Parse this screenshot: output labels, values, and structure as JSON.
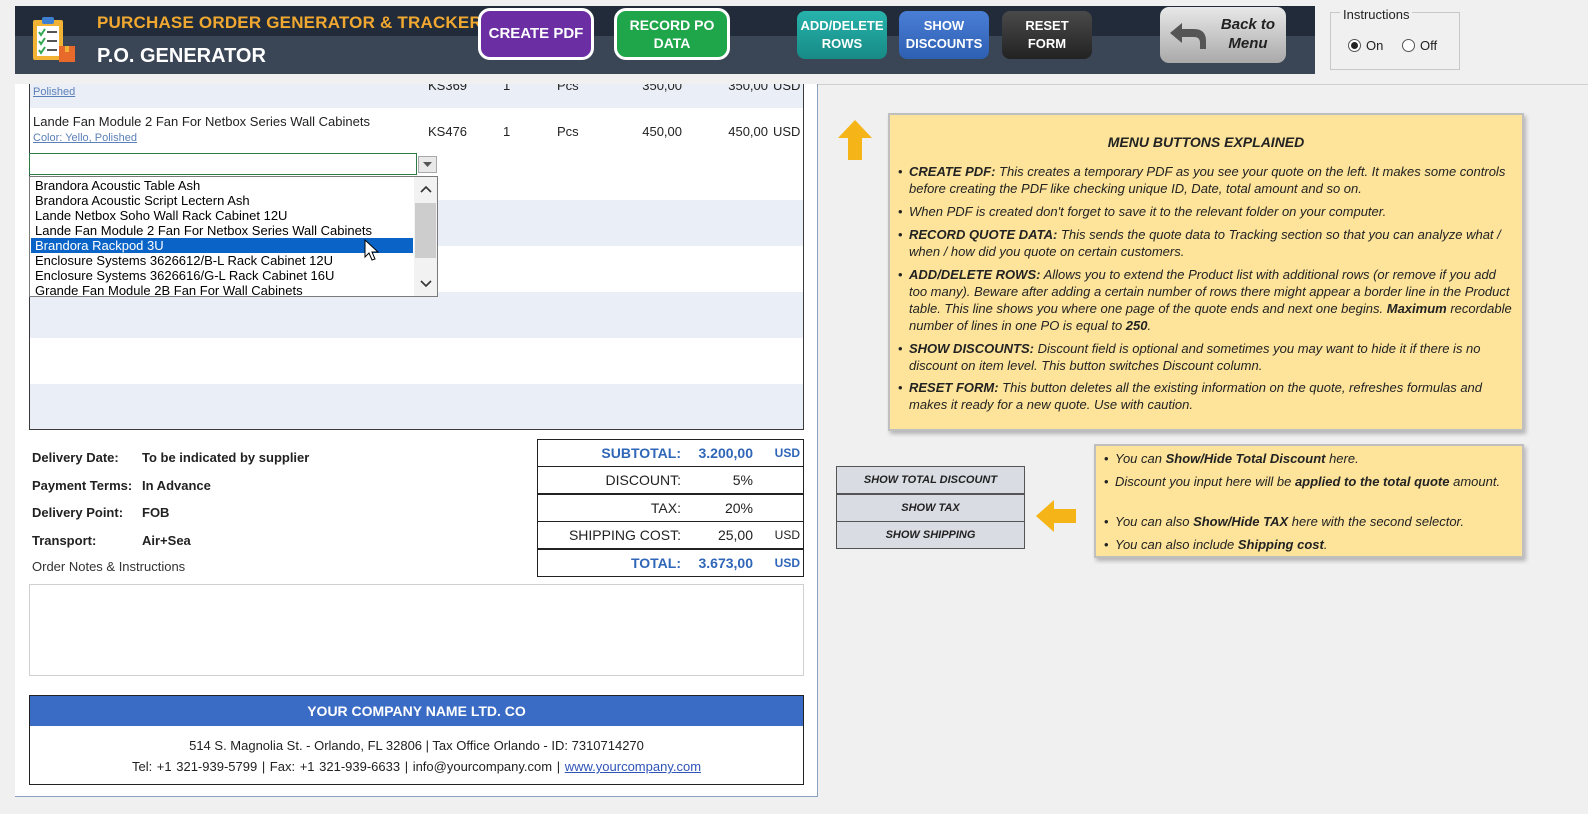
{
  "header": {
    "app_title": "PURCHASE ORDER GENERATOR & TRACKER",
    "sub_title": "P.O. GENERATOR",
    "buttons": {
      "create_pdf": "CREATE PDF",
      "record_po": "RECORD PO\nDATA",
      "add_delete": "ADD/DELETE\nROWS",
      "show_discounts": "SHOW\nDISCOUNTS",
      "reset_form": "RESET\nFORM",
      "back_to_menu": "Back to\nMenu"
    },
    "colors": {
      "header_bg": "#222b3a",
      "title_accent": "#f0a830",
      "pdf": "#6b2fa3",
      "record": "#1fa64a"
    }
  },
  "instructions": {
    "label": "Instructions",
    "on": "On",
    "off": "Off",
    "selected": "On"
  },
  "products": [
    {
      "name": "",
      "variant": "Polished",
      "code": "KS369",
      "qty": "1",
      "unit": "Pcs",
      "price": "350,00",
      "total": "350,00",
      "currency": "USD"
    },
    {
      "name": "Lande Fan Module 2 Fan For Netbox Series Wall Cabinets",
      "variant": "Color: Yello, Polished",
      "code": "KS476",
      "qty": "1",
      "unit": "Pcs",
      "price": "450,00",
      "total": "450,00",
      "currency": "USD"
    }
  ],
  "dropdown": {
    "items": [
      "Brandora Acoustic Table Ash",
      "Brandora Acoustic Script Lectern Ash",
      "Lande Netbox Soho Wall Rack Cabinet 12U",
      "Lande Fan Module 2 Fan For Netbox Series Wall Cabinets",
      "Brandora Rackpod 3U",
      "Enclosure Systems 3626612/B-L Rack Cabinet 12U",
      "Enclosure Systems 3626616/G-L Rack Cabinet 16U",
      "Grande Fan Module 2B Fan For Wall Cabinets"
    ],
    "selected_index": 4
  },
  "terms": {
    "delivery_date_label": "Delivery Date:",
    "delivery_date": "To be indicated by supplier",
    "payment_terms_label": "Payment Terms:",
    "payment_terms": "In Advance",
    "delivery_point_label": "Delivery Point:",
    "delivery_point": "FOB",
    "transport_label": "Transport:",
    "transport": "Air+Sea",
    "notes_label": "Order Notes & Instructions"
  },
  "totals": {
    "subtotal_label": "SUBTOTAL:",
    "subtotal": "3.200,00",
    "subtotal_unit": "USD",
    "discount_label": "DISCOUNT:",
    "discount": "5%",
    "tax_label": "TAX:",
    "tax": "20%",
    "shipping_label": "SHIPPING COST:",
    "shipping": "25,00",
    "shipping_unit": "USD",
    "total_label": "TOTAL:",
    "total": "3.673,00",
    "total_unit": "USD"
  },
  "footer": {
    "company": "YOUR COMPANY NAME LTD. CO",
    "address": "514 S. Magnolia St. - Orlando, FL 32806  |  Tax Office Orlando - ID: 7310714270",
    "contact": "Tel: +1 321-939-5799   |   Fax: +1 321-939-6633   |   info@yourcompany.com   |",
    "website": "www.yourcompany.com"
  },
  "menu_note": {
    "title": "MENU BUTTONS EXPLAINED",
    "items": [
      {
        "key": "CREATE PDF:",
        "text": " This creates a temporary PDF as you see your quote on the left. It makes some controls before creating the PDF like checking unique ID, Date, total amount and so on."
      },
      {
        "key": "",
        "text": "When PDF is created don't forget to save it to the relevant folder on your computer."
      },
      {
        "key": "RECORD QUOTE DATA:",
        "text": " This sends the quote data to Tracking section so that you can analyze what / when / how did you quote on certain customers."
      },
      {
        "key": "ADD/DELETE ROWS:",
        "text": " Allows you to extend the Product list with additional rows (or remove if you add too many). Beware after adding a certain number of rows there might appear a border line in the Product table. This line shows you where one page of the quote ends and next one begins.",
        "key2": "Maximum",
        "text2": " recordable number of lines in one PO is equal to ",
        "key3": "250",
        "text3": "."
      },
      {
        "key": "SHOW DISCOUNTS:",
        "text": " Discount field is optional and sometimes you may want to hide it if there is no discount on item level. This button switches Discount column."
      },
      {
        "key": "RESET FORM:",
        "text": " This button deletes all the existing information on the quote, refreshes formulas and makes it ready for a new quote. Use with caution."
      }
    ]
  },
  "side_buttons": {
    "show_total_discount": "SHOW TOTAL DISCOUNT",
    "show_tax": "SHOW TAX",
    "show_shipping": "SHOW SHIPPING"
  },
  "totals_note": {
    "l1a": "You can ",
    "l1b": "Show/Hide Total Discount",
    "l1c": " here.",
    "l2a": "Discount you input here will be ",
    "l2b": "applied to the total quote",
    "l2c": " amount.",
    "l3a": "You can also ",
    "l3b": "Show/Hide TAX",
    "l3c": " here with the second selector.",
    "l4a": "You can also include ",
    "l4b": "Shipping cost",
    "l4c": "."
  }
}
